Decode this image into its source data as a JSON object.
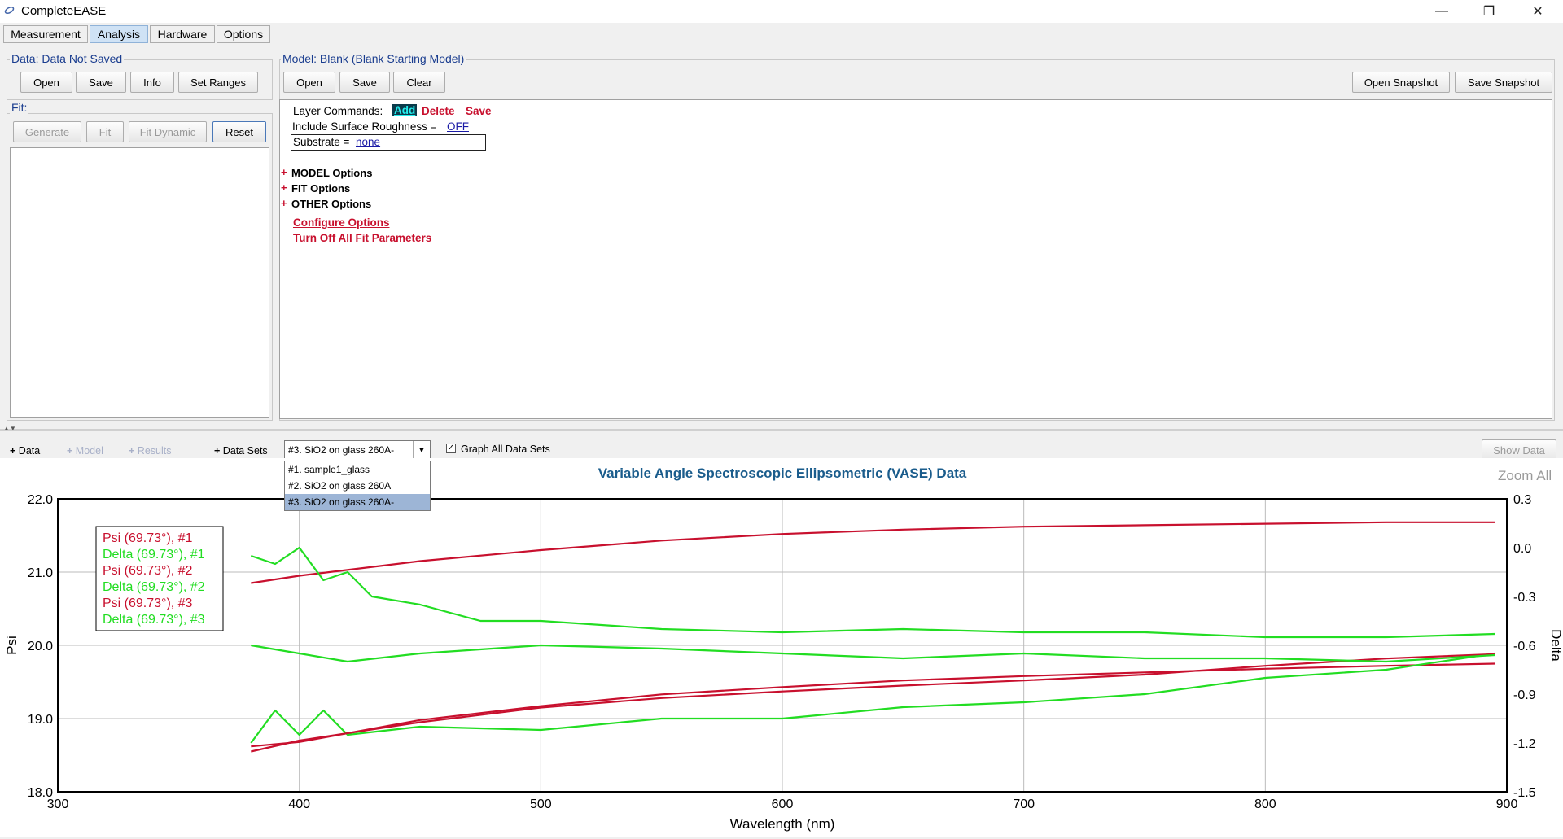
{
  "window": {
    "title": "CompleteEASE",
    "minimize": "—",
    "restore": "❐",
    "close": "✕"
  },
  "tabs": [
    "Measurement",
    "Analysis",
    "Hardware",
    "Options"
  ],
  "data_panel": {
    "title": "Data: Data Not Saved",
    "buttons": {
      "open": "Open",
      "save": "Save",
      "info": "Info",
      "set_ranges": "Set Ranges"
    }
  },
  "fit_panel": {
    "title": "Fit:",
    "buttons": {
      "generate": "Generate",
      "fit": "Fit",
      "fit_dynamic": "Fit Dynamic",
      "reset": "Reset"
    }
  },
  "model_panel": {
    "title": "Model:  Blank (Blank Starting Model)",
    "buttons": {
      "open": "Open",
      "save": "Save",
      "clear": "Clear",
      "open_snapshot": "Open Snapshot",
      "save_snapshot": "Save Snapshot"
    },
    "layer_commands_label": "Layer Commands:",
    "layer_add": "Add",
    "layer_delete": "Delete",
    "layer_save": "Save",
    "roughness_label": "Include Surface Roughness = ",
    "roughness_value": "OFF",
    "substrate_label": "Substrate = ",
    "substrate_value": "none",
    "plus": "+",
    "options": [
      "MODEL Options",
      "FIT Options",
      "OTHER Options"
    ],
    "configure_options": "Configure Options",
    "turn_off_fit": "Turn Off All Fit Parameters"
  },
  "graph_toolbar": {
    "data": "Data",
    "model": "Model",
    "results": "Results",
    "data_sets": "Data Sets",
    "selected_set": "#3.  SiO2 on glass 260A-",
    "dropdown_items": [
      "#1.  sample1_glass",
      "#2.  SiO2 on glass 260A",
      "#3.  SiO2 on glass 260A-"
    ],
    "graph_all": "Graph All Data Sets",
    "show_data": "Show Data",
    "zoom_all": "Zoom All"
  },
  "chart_data": {
    "type": "line",
    "title": "Variable Angle Spectroscopic Ellipsometric (VASE) Data",
    "xlabel": "Wavelength (nm)",
    "ylabel": "Psi",
    "y2label": "Delta",
    "xlim": [
      300,
      900
    ],
    "ylim": [
      18.0,
      22.0
    ],
    "y2lim": [
      -1.5,
      0.3
    ],
    "xticks": [
      "300",
      "400",
      "500",
      "600",
      "700",
      "800",
      "900"
    ],
    "yticks": [
      "18.0",
      "19.0",
      "20.0",
      "21.0",
      "22.0"
    ],
    "y2ticks": [
      "-1.5",
      "-1.2",
      "-0.9",
      "-0.6",
      "-0.3",
      "0.0",
      "0.3"
    ],
    "grid": true,
    "legend_position": "top-left",
    "colors": {
      "psi": "#c8102e",
      "delta": "#22dd22"
    },
    "series": [
      {
        "name": "Psi (69.73°), #1",
        "axis": "left",
        "x": [
          380,
          400,
          450,
          500,
          550,
          600,
          650,
          700,
          750,
          800,
          850,
          895
        ],
        "y": [
          20.85,
          20.95,
          21.15,
          21.3,
          21.43,
          21.52,
          21.58,
          21.62,
          21.64,
          21.66,
          21.68,
          21.68
        ]
      },
      {
        "name": "Delta (69.73°), #1",
        "axis": "right",
        "x": [
          380,
          390,
          400,
          410,
          420,
          430,
          450,
          475,
          500,
          550,
          600,
          650,
          700,
          750,
          800,
          850,
          895
        ],
        "y": [
          -0.05,
          -0.1,
          0.0,
          -0.2,
          -0.15,
          -0.3,
          -0.35,
          -0.45,
          -0.45,
          -0.5,
          -0.52,
          -0.5,
          -0.52,
          -0.52,
          -0.55,
          -0.55,
          -0.53
        ]
      },
      {
        "name": "Psi (69.73°), #2",
        "axis": "left",
        "x": [
          380,
          400,
          450,
          500,
          550,
          600,
          650,
          700,
          750,
          800,
          850,
          895
        ],
        "y": [
          18.62,
          18.68,
          18.98,
          19.17,
          19.33,
          19.43,
          19.52,
          19.58,
          19.63,
          19.68,
          19.72,
          19.75
        ]
      },
      {
        "name": "Delta (69.73°), #2",
        "axis": "right",
        "x": [
          380,
          390,
          400,
          410,
          420,
          450,
          500,
          550,
          600,
          650,
          700,
          750,
          800,
          850,
          895
        ],
        "y": [
          -1.2,
          -1.0,
          -1.15,
          -1.0,
          -1.15,
          -1.1,
          -1.12,
          -1.05,
          -1.05,
          -0.98,
          -0.95,
          -0.9,
          -0.8,
          -0.75,
          -0.65
        ]
      },
      {
        "name": "Psi (69.73°), #3",
        "axis": "left",
        "x": [
          380,
          400,
          450,
          500,
          550,
          600,
          650,
          700,
          750,
          800,
          850,
          895
        ],
        "y": [
          18.55,
          18.7,
          18.95,
          19.15,
          19.28,
          19.37,
          19.45,
          19.52,
          19.6,
          19.72,
          19.82,
          19.88
        ]
      },
      {
        "name": "Delta (69.73°), #3",
        "axis": "right",
        "x": [
          380,
          400,
          420,
          450,
          500,
          550,
          600,
          650,
          700,
          750,
          800,
          850,
          895
        ],
        "y": [
          -0.6,
          -0.65,
          -0.7,
          -0.65,
          -0.6,
          -0.62,
          -0.65,
          -0.68,
          -0.65,
          -0.68,
          -0.68,
          -0.7,
          -0.66
        ]
      }
    ]
  }
}
